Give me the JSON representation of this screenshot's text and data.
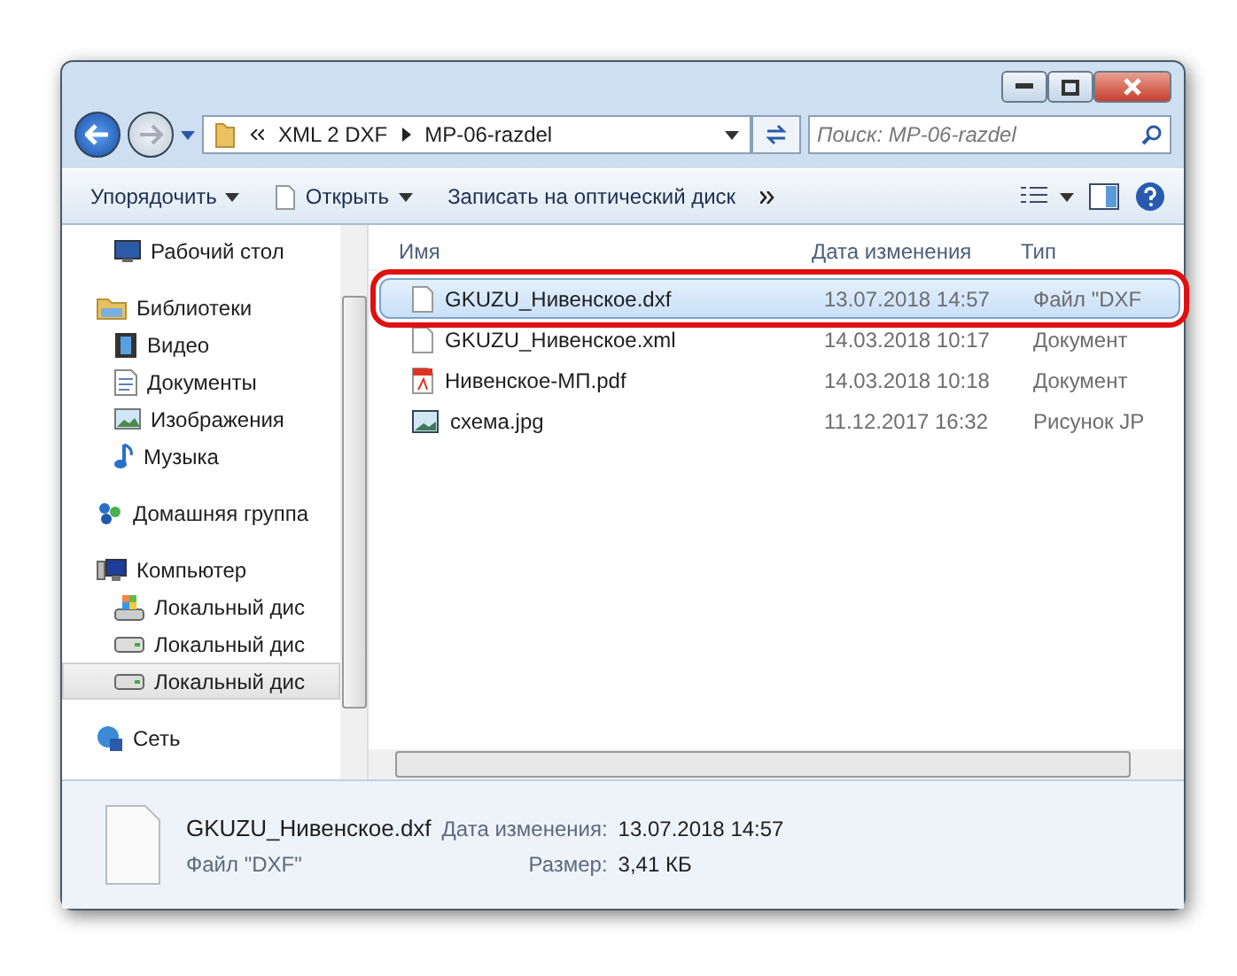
{
  "address": {
    "crumbs": [
      "XML 2 DXF",
      "MP-06-razdel"
    ]
  },
  "search": {
    "placeholder": "Поиск: MP-06-razdel"
  },
  "toolbar": [
    "Упорядочить",
    "Открыть",
    "Записать на оптический диск"
  ],
  "sidebar": {
    "items": [
      {
        "label": "Рабочий стол",
        "kind": "desktop",
        "selected": false
      },
      {
        "label": "Библиотеки",
        "kind": "library",
        "selected": false,
        "children": [
          {
            "label": "Видео",
            "kind": "video",
            "selected": false
          },
          {
            "label": "Документы",
            "kind": "docs",
            "selected": false
          },
          {
            "label": "Изображения",
            "kind": "pictures",
            "selected": false
          },
          {
            "label": "Музыка",
            "kind": "music",
            "selected": false
          }
        ]
      },
      {
        "label": "Домашняя группа",
        "kind": "homegroup",
        "selected": false
      },
      {
        "label": "Компьютер",
        "kind": "computer",
        "selected": false,
        "children": [
          {
            "label": "Локальный дис",
            "kind": "sysdrive",
            "selected": false
          },
          {
            "label": "Локальный дис",
            "kind": "drive",
            "selected": false
          },
          {
            "label": "Локальный дис",
            "kind": "drive",
            "selected": true
          }
        ]
      },
      {
        "label": "Сеть",
        "kind": "network",
        "selected": false
      }
    ]
  },
  "columns": [
    "Имя",
    "Дата изменения",
    "Тип"
  ],
  "files": [
    {
      "name": "GKUZU_Нивенское.dxf",
      "date": "13.07.2018 14:57",
      "type": "Файл \"DXF",
      "kind": "blank",
      "selected": true
    },
    {
      "name": "GKUZU_Нивенское.xml",
      "date": "14.03.2018 10:17",
      "type": "Документ",
      "kind": "blank",
      "selected": false
    },
    {
      "name": "Нивенское-МП.pdf",
      "date": "14.03.2018 10:18",
      "type": "Документ",
      "kind": "pdf",
      "selected": false
    },
    {
      "name": "схема.jpg",
      "date": "11.12.2017 16:32",
      "type": "Рисунок JP",
      "kind": "image",
      "selected": false
    }
  ],
  "details": {
    "name": "GKUZU_Нивенское.dxf",
    "date_label": "Дата изменения:",
    "date": "13.07.2018 14:57",
    "type": "Файл \"DXF\"",
    "size_label": "Размер:",
    "size": "3,41 КБ"
  }
}
